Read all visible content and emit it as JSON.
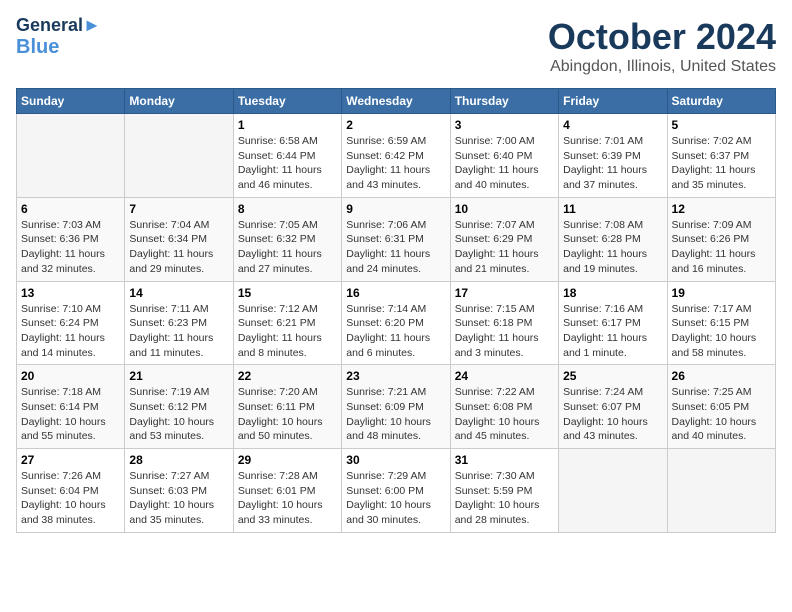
{
  "header": {
    "logo_general": "General",
    "logo_blue": "Blue",
    "title": "October 2024",
    "subtitle": "Abingdon, Illinois, United States"
  },
  "days_of_week": [
    "Sunday",
    "Monday",
    "Tuesday",
    "Wednesday",
    "Thursday",
    "Friday",
    "Saturday"
  ],
  "weeks": [
    [
      {
        "num": "",
        "sunrise": "",
        "sunset": "",
        "daylight": ""
      },
      {
        "num": "",
        "sunrise": "",
        "sunset": "",
        "daylight": ""
      },
      {
        "num": "1",
        "sunrise": "Sunrise: 6:58 AM",
        "sunset": "Sunset: 6:44 PM",
        "daylight": "Daylight: 11 hours and 46 minutes."
      },
      {
        "num": "2",
        "sunrise": "Sunrise: 6:59 AM",
        "sunset": "Sunset: 6:42 PM",
        "daylight": "Daylight: 11 hours and 43 minutes."
      },
      {
        "num": "3",
        "sunrise": "Sunrise: 7:00 AM",
        "sunset": "Sunset: 6:40 PM",
        "daylight": "Daylight: 11 hours and 40 minutes."
      },
      {
        "num": "4",
        "sunrise": "Sunrise: 7:01 AM",
        "sunset": "Sunset: 6:39 PM",
        "daylight": "Daylight: 11 hours and 37 minutes."
      },
      {
        "num": "5",
        "sunrise": "Sunrise: 7:02 AM",
        "sunset": "Sunset: 6:37 PM",
        "daylight": "Daylight: 11 hours and 35 minutes."
      }
    ],
    [
      {
        "num": "6",
        "sunrise": "Sunrise: 7:03 AM",
        "sunset": "Sunset: 6:36 PM",
        "daylight": "Daylight: 11 hours and 32 minutes."
      },
      {
        "num": "7",
        "sunrise": "Sunrise: 7:04 AM",
        "sunset": "Sunset: 6:34 PM",
        "daylight": "Daylight: 11 hours and 29 minutes."
      },
      {
        "num": "8",
        "sunrise": "Sunrise: 7:05 AM",
        "sunset": "Sunset: 6:32 PM",
        "daylight": "Daylight: 11 hours and 27 minutes."
      },
      {
        "num": "9",
        "sunrise": "Sunrise: 7:06 AM",
        "sunset": "Sunset: 6:31 PM",
        "daylight": "Daylight: 11 hours and 24 minutes."
      },
      {
        "num": "10",
        "sunrise": "Sunrise: 7:07 AM",
        "sunset": "Sunset: 6:29 PM",
        "daylight": "Daylight: 11 hours and 21 minutes."
      },
      {
        "num": "11",
        "sunrise": "Sunrise: 7:08 AM",
        "sunset": "Sunset: 6:28 PM",
        "daylight": "Daylight: 11 hours and 19 minutes."
      },
      {
        "num": "12",
        "sunrise": "Sunrise: 7:09 AM",
        "sunset": "Sunset: 6:26 PM",
        "daylight": "Daylight: 11 hours and 16 minutes."
      }
    ],
    [
      {
        "num": "13",
        "sunrise": "Sunrise: 7:10 AM",
        "sunset": "Sunset: 6:24 PM",
        "daylight": "Daylight: 11 hours and 14 minutes."
      },
      {
        "num": "14",
        "sunrise": "Sunrise: 7:11 AM",
        "sunset": "Sunset: 6:23 PM",
        "daylight": "Daylight: 11 hours and 11 minutes."
      },
      {
        "num": "15",
        "sunrise": "Sunrise: 7:12 AM",
        "sunset": "Sunset: 6:21 PM",
        "daylight": "Daylight: 11 hours and 8 minutes."
      },
      {
        "num": "16",
        "sunrise": "Sunrise: 7:14 AM",
        "sunset": "Sunset: 6:20 PM",
        "daylight": "Daylight: 11 hours and 6 minutes."
      },
      {
        "num": "17",
        "sunrise": "Sunrise: 7:15 AM",
        "sunset": "Sunset: 6:18 PM",
        "daylight": "Daylight: 11 hours and 3 minutes."
      },
      {
        "num": "18",
        "sunrise": "Sunrise: 7:16 AM",
        "sunset": "Sunset: 6:17 PM",
        "daylight": "Daylight: 11 hours and 1 minute."
      },
      {
        "num": "19",
        "sunrise": "Sunrise: 7:17 AM",
        "sunset": "Sunset: 6:15 PM",
        "daylight": "Daylight: 10 hours and 58 minutes."
      }
    ],
    [
      {
        "num": "20",
        "sunrise": "Sunrise: 7:18 AM",
        "sunset": "Sunset: 6:14 PM",
        "daylight": "Daylight: 10 hours and 55 minutes."
      },
      {
        "num": "21",
        "sunrise": "Sunrise: 7:19 AM",
        "sunset": "Sunset: 6:12 PM",
        "daylight": "Daylight: 10 hours and 53 minutes."
      },
      {
        "num": "22",
        "sunrise": "Sunrise: 7:20 AM",
        "sunset": "Sunset: 6:11 PM",
        "daylight": "Daylight: 10 hours and 50 minutes."
      },
      {
        "num": "23",
        "sunrise": "Sunrise: 7:21 AM",
        "sunset": "Sunset: 6:09 PM",
        "daylight": "Daylight: 10 hours and 48 minutes."
      },
      {
        "num": "24",
        "sunrise": "Sunrise: 7:22 AM",
        "sunset": "Sunset: 6:08 PM",
        "daylight": "Daylight: 10 hours and 45 minutes."
      },
      {
        "num": "25",
        "sunrise": "Sunrise: 7:24 AM",
        "sunset": "Sunset: 6:07 PM",
        "daylight": "Daylight: 10 hours and 43 minutes."
      },
      {
        "num": "26",
        "sunrise": "Sunrise: 7:25 AM",
        "sunset": "Sunset: 6:05 PM",
        "daylight": "Daylight: 10 hours and 40 minutes."
      }
    ],
    [
      {
        "num": "27",
        "sunrise": "Sunrise: 7:26 AM",
        "sunset": "Sunset: 6:04 PM",
        "daylight": "Daylight: 10 hours and 38 minutes."
      },
      {
        "num": "28",
        "sunrise": "Sunrise: 7:27 AM",
        "sunset": "Sunset: 6:03 PM",
        "daylight": "Daylight: 10 hours and 35 minutes."
      },
      {
        "num": "29",
        "sunrise": "Sunrise: 7:28 AM",
        "sunset": "Sunset: 6:01 PM",
        "daylight": "Daylight: 10 hours and 33 minutes."
      },
      {
        "num": "30",
        "sunrise": "Sunrise: 7:29 AM",
        "sunset": "Sunset: 6:00 PM",
        "daylight": "Daylight: 10 hours and 30 minutes."
      },
      {
        "num": "31",
        "sunrise": "Sunrise: 7:30 AM",
        "sunset": "Sunset: 5:59 PM",
        "daylight": "Daylight: 10 hours and 28 minutes."
      },
      {
        "num": "",
        "sunrise": "",
        "sunset": "",
        "daylight": ""
      },
      {
        "num": "",
        "sunrise": "",
        "sunset": "",
        "daylight": ""
      }
    ]
  ]
}
